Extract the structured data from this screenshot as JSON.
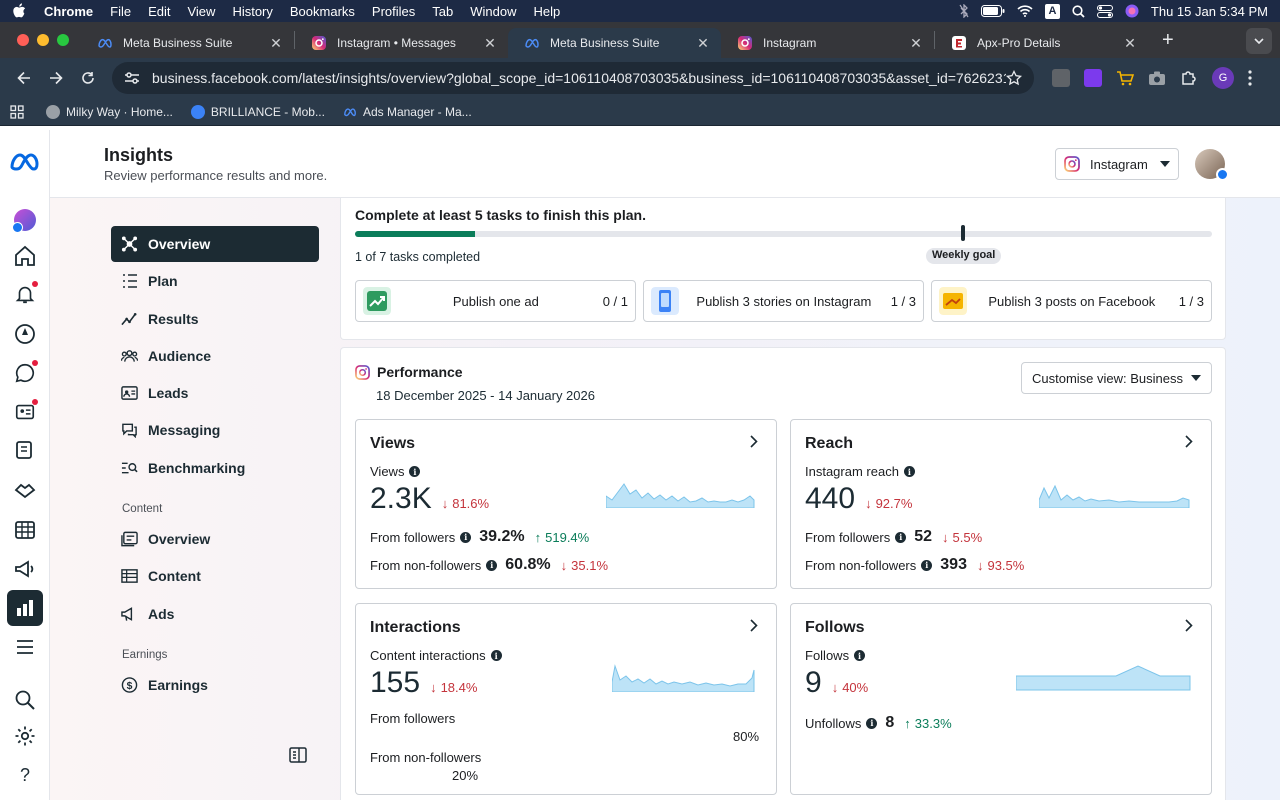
{
  "menubar": {
    "app": "Chrome",
    "items": [
      "File",
      "Edit",
      "View",
      "History",
      "Bookmarks",
      "Profiles",
      "Tab",
      "Window",
      "Help"
    ],
    "clock": "Thu 15 Jan  5:34 PM",
    "input_source": "A"
  },
  "tabs": [
    {
      "title": "Meta Business Suite",
      "icon": "meta-icon",
      "active": false
    },
    {
      "title": "Instagram • Messages",
      "icon": "instagram-icon",
      "active": false
    },
    {
      "title": "Meta Business Suite",
      "icon": "meta-icon",
      "active": true
    },
    {
      "title": "Instagram",
      "icon": "instagram-icon",
      "active": false
    },
    {
      "title": "Apx-Pro Details",
      "icon": "apx-icon",
      "active": false
    }
  ],
  "omnibox": {
    "url": "business.facebook.com/latest/insights/overview?global_scope_id=106110408703035&business_id=106110408703035&asset_id=762623143..."
  },
  "bookmarks": [
    {
      "label": "Milky Way · Home...",
      "color": "#9aa0a6"
    },
    {
      "label": "BRILLIANCE - Mob...",
      "color": "#3b82f6"
    },
    {
      "label": "Ads Manager - Ma...",
      "color": "#1877f2"
    }
  ],
  "header": {
    "title": "Insights",
    "subtitle": "Review performance results and more.",
    "account_label": "Instagram"
  },
  "sidenav": {
    "items": [
      {
        "label": "Overview",
        "icon": "overview-icon",
        "active": true
      },
      {
        "label": "Plan",
        "icon": "plan-icon"
      },
      {
        "label": "Results",
        "icon": "results-icon"
      },
      {
        "label": "Audience",
        "icon": "audience-icon"
      },
      {
        "label": "Leads",
        "icon": "leads-icon"
      },
      {
        "label": "Messaging",
        "icon": "messaging-icon"
      },
      {
        "label": "Benchmarking",
        "icon": "benchmarking-icon"
      }
    ],
    "content_section": "Content",
    "content_items": [
      {
        "label": "Overview",
        "icon": "content-overview-icon"
      },
      {
        "label": "Content",
        "icon": "content-table-icon"
      },
      {
        "label": "Ads",
        "icon": "ads-icon"
      }
    ],
    "earnings_section": "Earnings",
    "earnings_items": [
      {
        "label": "Earnings",
        "icon": "earnings-icon"
      }
    ]
  },
  "plan": {
    "title": "Complete at least 5 tasks to finish this plan.",
    "progress": 0.14,
    "goal_position": 0.71,
    "tasks_completed": "1 of 7 tasks completed",
    "goal_label": "Weekly goal",
    "tasks": [
      {
        "label": "Publish one ad",
        "count": "0 / 1"
      },
      {
        "label": "Publish 3 stories on Instagram",
        "count": "1 / 3"
      },
      {
        "label": "Publish 3 posts on Facebook",
        "count": "1 / 3"
      }
    ]
  },
  "performance": {
    "title": "Performance",
    "date_range": "18 December 2025 - 14 January 2026",
    "customise_label": "Customise view: Business",
    "views": {
      "title": "Views",
      "subtitle": "Views",
      "value": "2.3K",
      "change": "81.6%",
      "followers_label": "From followers",
      "followers_value": "39.2%",
      "followers_change": "519.4%",
      "nonfollowers_label": "From non-followers",
      "nonfollowers_value": "60.8%",
      "nonfollowers_change": "35.1%"
    },
    "reach": {
      "title": "Reach",
      "subtitle": "Instagram reach",
      "value": "440",
      "change": "92.7%",
      "followers_label": "From followers",
      "followers_value": "52",
      "followers_change": "5.5%",
      "nonfollowers_label": "From non-followers",
      "nonfollowers_value": "393",
      "nonfollowers_change": "93.5%"
    },
    "interactions": {
      "title": "Interactions",
      "subtitle": "Content interactions",
      "value": "155",
      "change": "18.4%",
      "followers_label": "From followers",
      "followers_pct": "80%",
      "nonfollowers_label": "From non-followers",
      "nonfollowers_pct": "20%"
    },
    "follows": {
      "title": "Follows",
      "subtitle": "Follows",
      "value": "9",
      "change": "40%",
      "unfollows_label": "Unfollows",
      "unfollows_value": "8",
      "unfollows_change": "33.3%"
    }
  },
  "colors": {
    "accent": "#1c2b33",
    "progress": "#0b7d5a",
    "down": "#c4343c",
    "up": "#0b7d5a",
    "spark_fill": "#bde3f7",
    "spark_line": "#7cc4ea"
  }
}
